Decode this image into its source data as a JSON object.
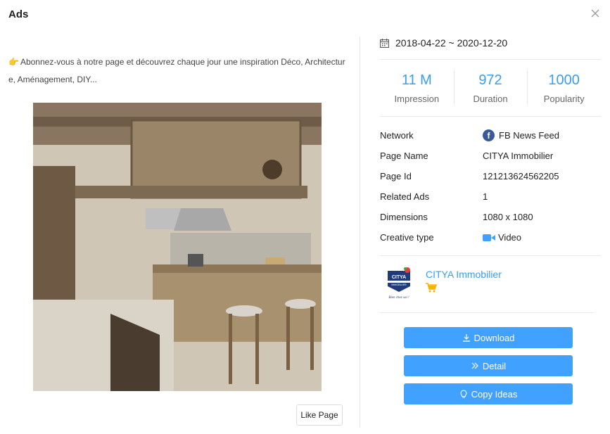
{
  "modal": {
    "title": "Ads"
  },
  "ad": {
    "text": "Abonnez-vous à notre page et découvrez chaque jour une inspiration Déco, Architecture, Aménagement, DIY...",
    "like_page_label": "Like Page"
  },
  "date_range": "2018-04-22 ~ 2020-12-20",
  "stats": [
    {
      "value": "11 M",
      "label": "Impression"
    },
    {
      "value": "972",
      "label": "Duration"
    },
    {
      "value": "1000",
      "label": "Popularity"
    }
  ],
  "details": [
    {
      "key": "Network",
      "value": "FB News Feed",
      "icon": "facebook-icon"
    },
    {
      "key": "Page Name",
      "value": "CITYA Immobilier"
    },
    {
      "key": "Page Id",
      "value": "121213624562205"
    },
    {
      "key": "Related Ads",
      "value": "1"
    },
    {
      "key": "Dimensions",
      "value": "1080 x 1080"
    },
    {
      "key": "Creative type",
      "value": "Video",
      "icon": "video-camera-icon"
    }
  ],
  "page": {
    "name": "CITYA Immobilier",
    "logo_text": "CITYA",
    "logo_sub": "IMMOBILIER",
    "logo_slogan": "Bien chez soi !"
  },
  "actions": {
    "download": "Download",
    "detail": "Detail",
    "copy_ideas": "Copy Ideas"
  },
  "colors": {
    "accent": "#3a9df0",
    "button": "#41a1ff",
    "facebook": "#3b5998",
    "cart": "#f5b400"
  }
}
